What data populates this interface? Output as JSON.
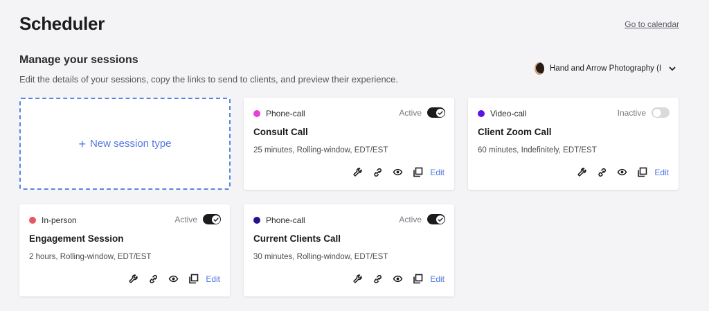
{
  "header": {
    "title": "Scheduler",
    "calendar_link": "Go to calendar"
  },
  "section": {
    "title": "Manage your sessions",
    "description": "Edit the details of your sessions, copy the links to send to clients, and preview their experience."
  },
  "account": {
    "name": "Hand and Arrow Photography (I"
  },
  "new_session": {
    "plus": "+",
    "label": "New session type"
  },
  "sessions": [
    {
      "type": "Phone-call",
      "type_color": "#e83fd6",
      "status": "Active",
      "active": true,
      "name": "Consult Call",
      "details": "25 minutes, Rolling-window, EDT/EST",
      "edit_label": "Edit"
    },
    {
      "type": "Video-call",
      "type_color": "#5a14e6",
      "status": "Inactive",
      "active": false,
      "name": "Client Zoom Call",
      "details": "60 minutes, Indefinitely, EDT/EST",
      "edit_label": "Edit"
    },
    {
      "type": "In-person",
      "type_color": "#e8565e",
      "status": "Active",
      "active": true,
      "name": "Engagement Session",
      "details": "2 hours, Rolling-window, EDT/EST",
      "edit_label": "Edit"
    },
    {
      "type": "Phone-call",
      "type_color": "#2a0e8c",
      "status": "Active",
      "active": true,
      "name": "Current Clients Call",
      "details": "30 minutes, Rolling-window, EDT/EST",
      "edit_label": "Edit"
    }
  ],
  "action_icons": [
    "wrench-icon",
    "link-icon",
    "eye-icon",
    "copy-icon"
  ]
}
